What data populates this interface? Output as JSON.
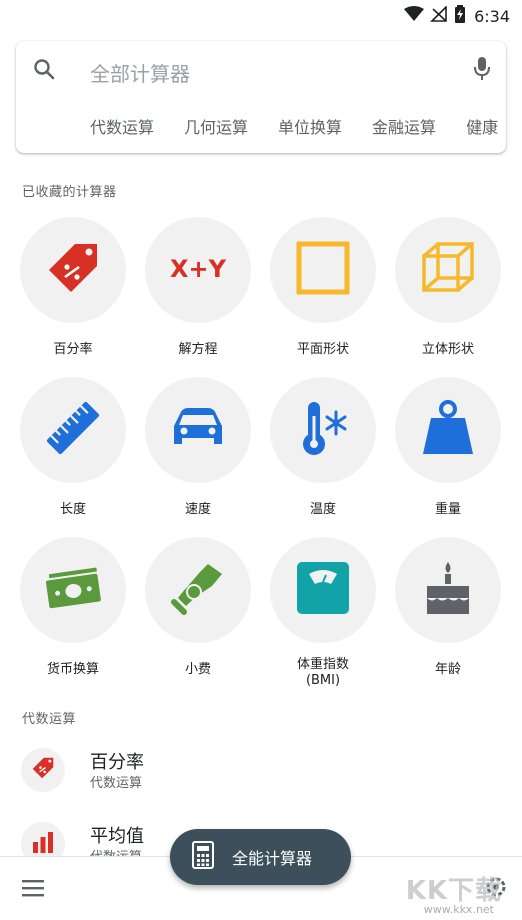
{
  "status": {
    "time": "6:34"
  },
  "search": {
    "placeholder": "全部计算器",
    "chips": [
      "代数运算",
      "几何运算",
      "单位换算",
      "金融运算",
      "健康"
    ]
  },
  "favorites": {
    "title": "已收藏的计算器",
    "items": [
      {
        "label": "百分率",
        "icon": "percent-tag-icon",
        "color": "#d93025"
      },
      {
        "label": "解方程",
        "icon": "x-plus-y-icon",
        "color": "#d93025"
      },
      {
        "label": "平面形状",
        "icon": "square-icon",
        "color": "#f6b92b"
      },
      {
        "label": "立体形状",
        "icon": "cube-icon",
        "color": "#f6b92b"
      },
      {
        "label": "长度",
        "icon": "ruler-icon",
        "color": "#1e6fd9"
      },
      {
        "label": "速度",
        "icon": "car-icon",
        "color": "#1e6fd9"
      },
      {
        "label": "温度",
        "icon": "thermometer-icon",
        "color": "#1e6fd9"
      },
      {
        "label": "重量",
        "icon": "weight-icon",
        "color": "#1e6fd9"
      },
      {
        "label": "货币换算",
        "icon": "money-icon",
        "color": "#5a9a3c"
      },
      {
        "label": "小费",
        "icon": "tip-hand-icon",
        "color": "#5a9a3c"
      },
      {
        "label": "体重指数\n(BMI)",
        "icon": "scale-icon",
        "color": "#12a3a8"
      },
      {
        "label": "年龄",
        "icon": "cake-icon",
        "color": "#5f6368"
      }
    ]
  },
  "algebra": {
    "title": "代数运算",
    "items": [
      {
        "title": "百分率",
        "subtitle": "代数运算",
        "icon": "percent-tag-icon"
      },
      {
        "title": "平均值",
        "subtitle": "代数运算",
        "icon": "bar-chart-icon"
      }
    ]
  },
  "fab": {
    "label": "全能计算器",
    "icon": "calculator-icon"
  },
  "watermark": {
    "text": "KK下载",
    "url": "www.kkx.net"
  }
}
